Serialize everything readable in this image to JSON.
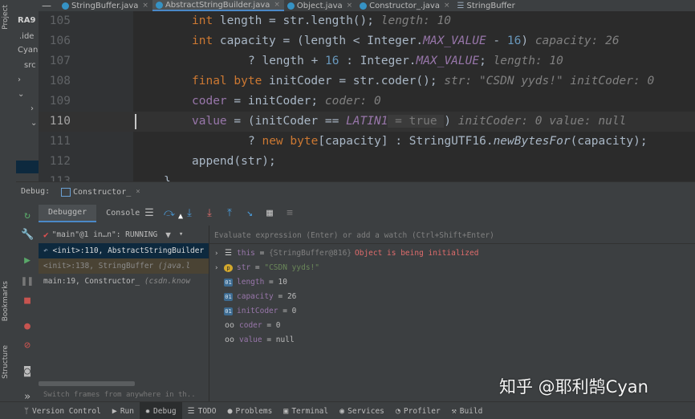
{
  "left_strip": {
    "project_label": "Project",
    "bookmarks_label": "Bookmarks",
    "structure_label": "Structure"
  },
  "project_panel": {
    "rows": [
      "RA9",
      ".ide",
      "Cyan",
      "src",
      "",
      "",
      "",
      ""
    ]
  },
  "tabs": [
    {
      "label": "StringBuffer.java",
      "active": false
    },
    {
      "label": "AbstractStringBuilder.java",
      "active": true
    },
    {
      "label": "Object.java",
      "active": false
    },
    {
      "label": "Constructor_.java",
      "active": false
    },
    {
      "label": "StringBuffer",
      "active": false
    }
  ],
  "editor": {
    "current_line": 110,
    "lines": [
      {
        "num": "105",
        "code": "int length = str.length();",
        "hint": "length: 10"
      },
      {
        "num": "106",
        "code": "int capacity = (length < Integer.MAX_VALUE - 16)",
        "hint": "capacity: 26"
      },
      {
        "num": "107",
        "code": "? length + 16 : Integer.MAX_VALUE;",
        "hint": "length: 10"
      },
      {
        "num": "108",
        "code": "final byte initCoder = str.coder();",
        "hint": "str: \"CSDN yyds!\"   initCoder: 0"
      },
      {
        "num": "109",
        "code": "coder = initCoder;",
        "hint": "coder: 0"
      },
      {
        "num": "110",
        "code": "value = (initCoder == LATIN1 = true )",
        "hint": "initCoder: 0   value: null"
      },
      {
        "num": "111",
        "code": "? new byte[capacity] : StringUTF16.newBytesFor(capacity);",
        "hint": ""
      },
      {
        "num": "112",
        "code": "append(str);",
        "hint": ""
      },
      {
        "num": "113",
        "code": "}",
        "hint": ""
      }
    ]
  },
  "debug": {
    "title": "Debug:",
    "run_config": "Constructor_",
    "subtabs": [
      "Debugger",
      "Console"
    ],
    "thread": {
      "label": "\"main\"@1 in…n\": RUNNING"
    },
    "frames": [
      {
        "method": "<init>:110, AbstractStringBuilder",
        "location": "",
        "style": "sel"
      },
      {
        "method": "<init>:138, StringBuffer",
        "location": "(java.l",
        "style": "lib"
      },
      {
        "method": "main:19, Constructor_",
        "location": "(csdn.know",
        "style": "plain"
      }
    ],
    "frames_hint": "Switch frames from anywhere in th..",
    "evaluate_placeholder": "Evaluate expression (Enter) or add a watch (Ctrl+Shift+Enter)",
    "variables": [
      {
        "expand": true,
        "badge": "list",
        "name": "this",
        "value_ref": "{StringBuffer@816}",
        "value_extra": "Object is being initialized"
      },
      {
        "expand": true,
        "badge": "p",
        "name": "str",
        "value_str": "\"CSDN yyds!\""
      },
      {
        "expand": false,
        "badge": "o",
        "name": "length",
        "value": "10"
      },
      {
        "expand": false,
        "badge": "o",
        "name": "capacity",
        "value": "26"
      },
      {
        "expand": false,
        "badge": "o",
        "name": "initCoder",
        "value": "0"
      },
      {
        "expand": false,
        "badge": "oo",
        "name": "coder",
        "value": "0"
      },
      {
        "expand": false,
        "badge": "oo",
        "name": "value",
        "value": "null"
      }
    ]
  },
  "watermark": "知乎 @耶利鹄Cyan",
  "bottom_bar": [
    {
      "label": "Version Control",
      "icon": "branch-icon",
      "active": false
    },
    {
      "label": "Run",
      "icon": "run-icon",
      "active": false
    },
    {
      "label": "Debug",
      "icon": "bug-icon",
      "active": true
    },
    {
      "label": "TODO",
      "icon": "list-icon",
      "active": false
    },
    {
      "label": "Problems",
      "icon": "problems-icon",
      "active": false
    },
    {
      "label": "Terminal",
      "icon": "terminal-icon",
      "active": false
    },
    {
      "label": "Services",
      "icon": "services-icon",
      "active": false
    },
    {
      "label": "Profiler",
      "icon": "profiler-icon",
      "active": false
    },
    {
      "label": "Build",
      "icon": "build-icon",
      "active": false
    }
  ],
  "colors": {
    "keyword": "#cc7832",
    "number": "#6897bb",
    "constant": "#9876aa",
    "hint": "#808080",
    "selection": "#0d293e",
    "accent": "#4a88c7"
  }
}
